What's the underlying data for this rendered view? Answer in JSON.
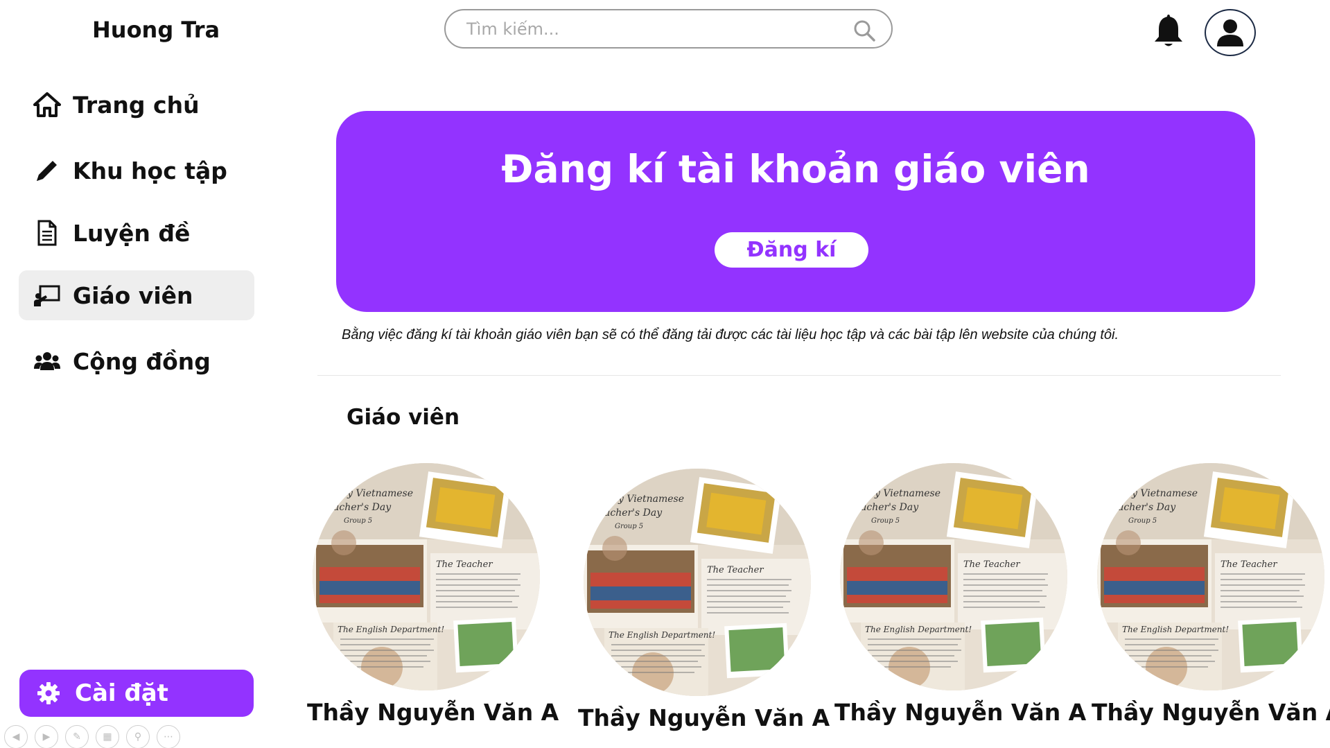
{
  "sidebar": {
    "brand": "Huong Tra",
    "items": [
      {
        "label": "Trang chủ",
        "icon": "home-icon"
      },
      {
        "label": "Khu học tập",
        "icon": "pencil-icon"
      },
      {
        "label": "Luyện đề",
        "icon": "document-icon"
      },
      {
        "label": "Giáo viên",
        "icon": "teacher-board-icon",
        "active": true
      },
      {
        "label": "Cộng đồng",
        "icon": "users-icon"
      }
    ],
    "settings_label": "Cài đặt"
  },
  "header": {
    "search_placeholder": "Tìm kiếm..."
  },
  "banner": {
    "title": "Đăng kí tài khoản giáo viên",
    "button_label": "Đăng kí",
    "color": "#9333ff"
  },
  "description": "Bằng việc đăng kí tài khoản giáo viên bạn sẽ có thể đăng tải được các tài liệu học tập và các bài tập lên website của chúng tôi.",
  "teachers_section": {
    "title": "Giáo viên",
    "teachers": [
      {
        "name": "Thầy Nguyễn Văn A"
      },
      {
        "name": "Thầy Nguyễn Văn A"
      },
      {
        "name": "Thầy Nguyễn Văn A"
      },
      {
        "name": "Thầy Nguyễn Văn A"
      }
    ],
    "photo_text": {
      "line1": "y Vietnamese",
      "line2": "acher's Day",
      "line3": "Group 5",
      "teacher_heading": "The Teacher",
      "dept_heading": "The English Department!"
    }
  }
}
